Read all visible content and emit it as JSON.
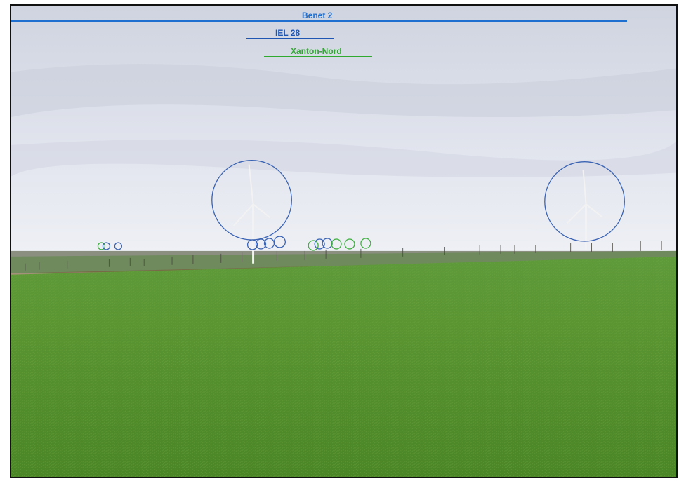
{
  "annotations": [
    {
      "name": "Benet 2",
      "color": "#1f6fd1"
    },
    {
      "name": "IEL 28",
      "color": "#1f55b3"
    },
    {
      "name": "Xanton-Nord",
      "color": "#2faa2f"
    }
  ],
  "colors": {
    "sky_top": "#d5d9e4",
    "sky_horizon": "#ecedf3",
    "field_far": "#5f9a3c",
    "field_near": "#4f8a2a",
    "marker_blue": "#3a63b3",
    "marker_green": "#3fae3f"
  }
}
